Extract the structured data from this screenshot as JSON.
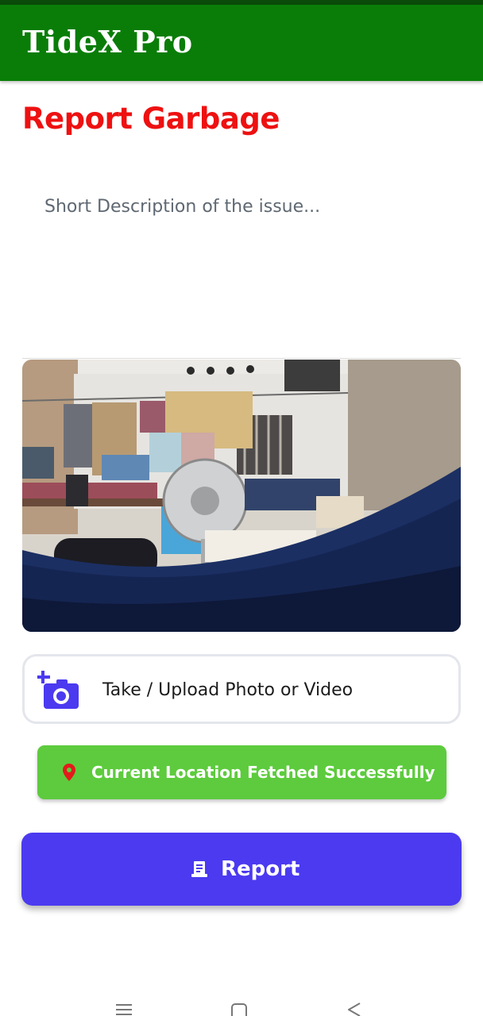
{
  "app": {
    "title": "TideX Pro"
  },
  "page": {
    "heading": "Report Garbage"
  },
  "description": {
    "placeholder": "Short Description of the issue..."
  },
  "media": {
    "preview_alt": "Uploaded photo preview",
    "upload_label": "Take / Upload Photo or Video",
    "upload_icon": "add-a-photo-icon"
  },
  "location": {
    "status": "Current Location Fetched Successfully",
    "icon": "location-pin-icon"
  },
  "actions": {
    "report_label": "Report",
    "report_icon": "receipt-icon"
  },
  "navigation": {
    "recents_icon": "recents-icon",
    "home_icon": "home-icon",
    "back_icon": "back-icon"
  },
  "colors": {
    "app_bar": "#0a7d08",
    "heading": "#ee1111",
    "location_banner": "#5dcb3d",
    "report_button": "#4b3af0",
    "camera_icon": "#4b3af0"
  }
}
